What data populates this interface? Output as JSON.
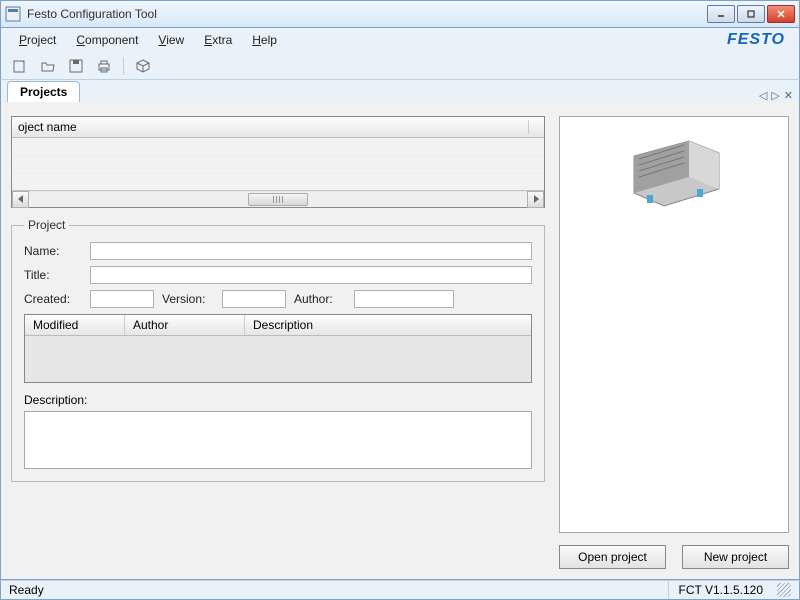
{
  "window": {
    "title": "Festo Configuration Tool"
  },
  "menu": {
    "project": "Project",
    "component": "Component",
    "view": "View",
    "extra": "Extra",
    "help": "Help"
  },
  "brand": "FESTO",
  "tabs": {
    "projects": "Projects"
  },
  "grid": {
    "col_project_name": "oject name"
  },
  "project_group": {
    "legend": "Project",
    "name_label": "Name:",
    "title_label": "Title:",
    "created_label": "Created:",
    "version_label": "Version:",
    "author_label": "Author:",
    "name_value": "",
    "title_value": "",
    "created_value": "",
    "version_value": "",
    "author_value": ""
  },
  "history_table": {
    "col_modified": "Modified",
    "col_author": "Author",
    "col_description": "Description"
  },
  "description_label": "Description:",
  "buttons": {
    "open_project": "Open project",
    "new_project": "New project"
  },
  "status": {
    "ready": "Ready",
    "version": "FCT V1.1.5.120"
  }
}
